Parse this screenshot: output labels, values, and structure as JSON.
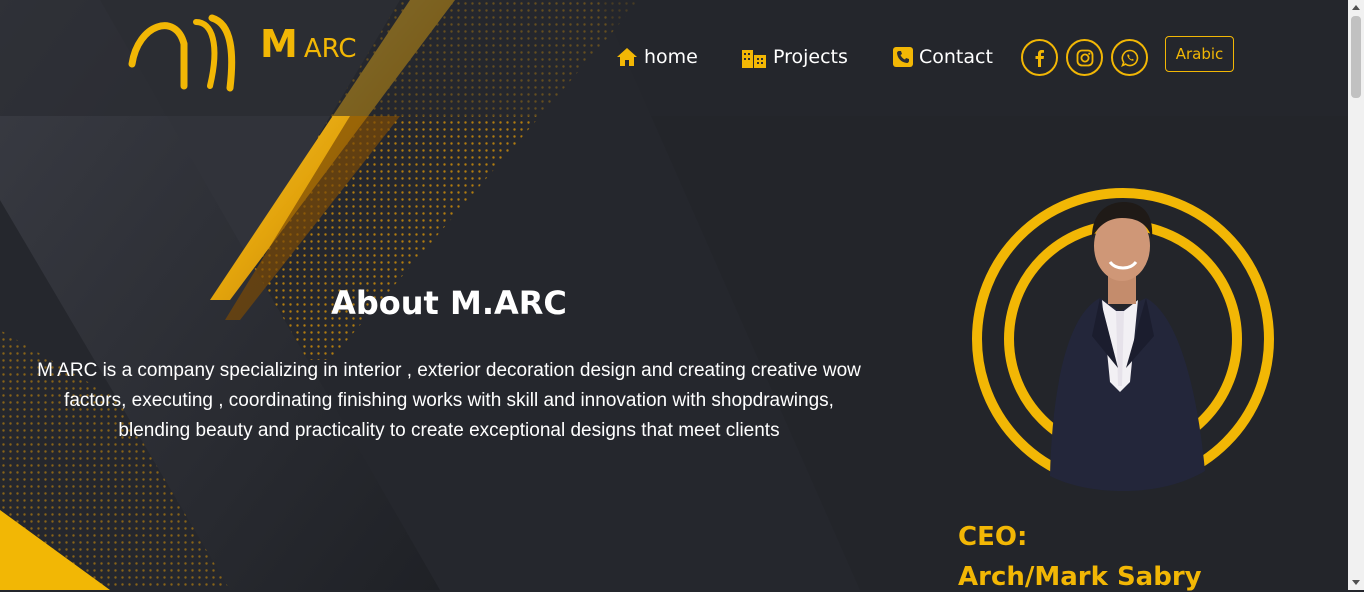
{
  "brand": {
    "name_initial": "M",
    "name_rest": "ARC"
  },
  "nav": {
    "home": "home",
    "projects": "Projects",
    "contact": "Contact",
    "language": "Arabic"
  },
  "social": [
    "facebook-icon",
    "instagram-icon",
    "whatsapp-icon"
  ],
  "about": {
    "title": "About M.ARC",
    "line1": "M ARC is a company specializing in interior , exterior decoration design and creating creative wow",
    "line2": "factors, executing , coordinating finishing works with skill and innovation with shopdrawings,",
    "line3": "blending beauty and practicality to create exceptional designs that meet clients"
  },
  "ceo": {
    "label": "CEO:",
    "name": "Arch/Mark Sabry"
  },
  "colors": {
    "accent": "#f2b705",
    "background": "#24262c",
    "navbar": "#2b2d33"
  }
}
